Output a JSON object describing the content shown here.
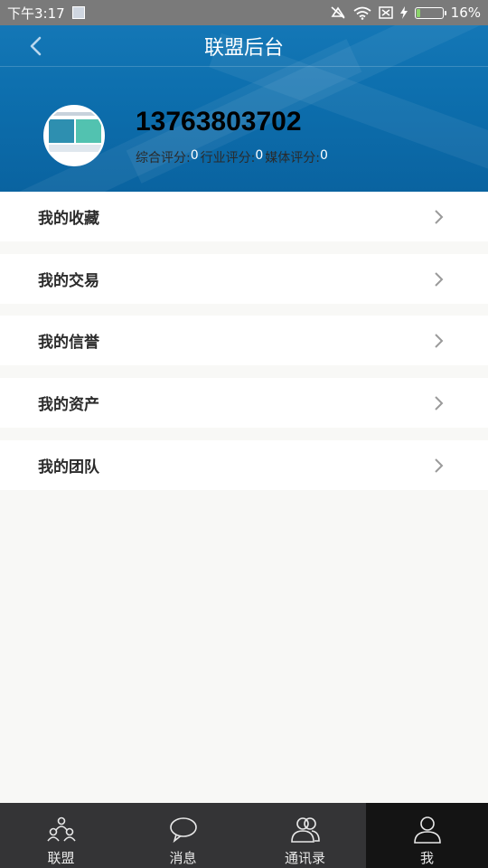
{
  "status_bar": {
    "time": "下午3:17",
    "battery": "16%",
    "battery_level": 0.16
  },
  "header": {
    "title": "联盟后台",
    "phone": "13763803702",
    "scores": [
      {
        "label": "综合评分: ",
        "value": "0"
      },
      {
        "label": "行业评分: ",
        "value": "0"
      },
      {
        "label": "媒体评分: ",
        "value": "0"
      }
    ]
  },
  "menu": [
    {
      "label": "我的收藏"
    },
    {
      "label": "我的交易"
    },
    {
      "label": "我的信誉"
    },
    {
      "label": "我的资产"
    },
    {
      "label": "我的团队"
    }
  ],
  "tabs": [
    {
      "label": "联盟",
      "icon": "team-icon"
    },
    {
      "label": "消息",
      "icon": "chat-icon"
    },
    {
      "label": "通讯录",
      "icon": "contacts-icon"
    },
    {
      "label": "我",
      "icon": "person-icon",
      "active": true
    }
  ]
}
